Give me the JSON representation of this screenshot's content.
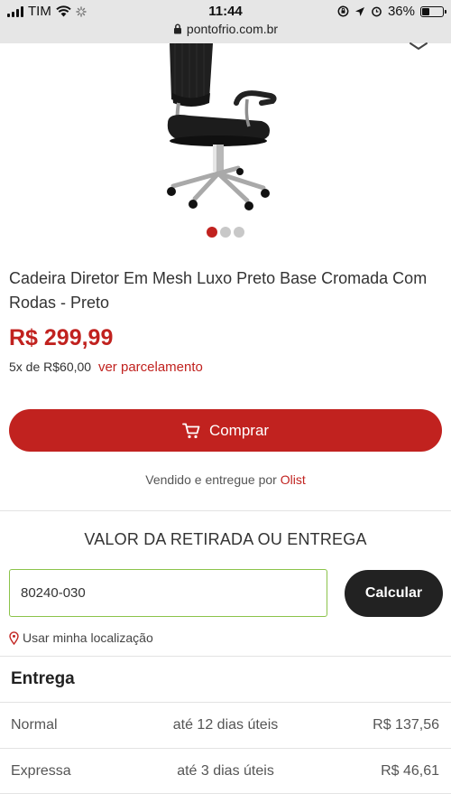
{
  "status_bar": {
    "carrier": "TIM",
    "time": "11:44",
    "battery": "36%",
    "battery_level": 0.36,
    "url": "pontofrio.com.br"
  },
  "product": {
    "title": "Cadeira Diretor Em Mesh Luxo Preto Base Cromada Com Rodas - Preto",
    "price": "R$ 299,99",
    "installments": "5x de R$60,00",
    "installments_link": "ver parcelamento",
    "carousel_pages": 3,
    "carousel_active": 1
  },
  "buy_button": {
    "label": "Comprar",
    "icon": "cart-icon"
  },
  "seller": {
    "prefix": "Vendido e entregue por",
    "name": "Olist"
  },
  "shipping": {
    "section_title": "VALOR DA RETIRADA OU ENTREGA",
    "cep_value": "80240-030",
    "calc_label": "Calcular",
    "location_link": "Usar minha localização",
    "entrega_title": "Entrega",
    "rows": [
      {
        "name": "Normal",
        "time": "até 12 dias úteis",
        "price": "R$ 137,56"
      },
      {
        "name": "Expressa",
        "time": "até 3 dias úteis",
        "price": "R$ 46,61"
      }
    ]
  },
  "colors": {
    "brand_red": "#c1221f",
    "dark": "#222222",
    "input_border": "#8bc34a"
  }
}
